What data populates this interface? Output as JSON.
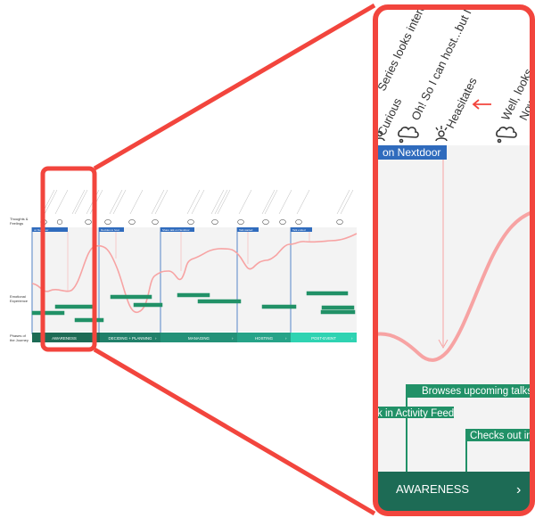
{
  "row_labels": {
    "thoughts": [
      "Thoughts &",
      "Feelings"
    ],
    "emotional": [
      "Emotional",
      "Experience"
    ],
    "phases": [
      "Phases of",
      "the Journey"
    ]
  },
  "phases": [
    {
      "label": "AWARENESS",
      "color": "#1d6b55"
    },
    {
      "label": "DECIDING + PLANNING",
      "color": "#21806a"
    },
    {
      "label": "MANAGING",
      "color": "#239178"
    },
    {
      "label": "HOSTING",
      "color": "#26a388"
    },
    {
      "label": "POST-EVENT",
      "color": "#2fd3b2"
    }
  ],
  "phase_arrow": "›",
  "stage_headers": [
    "on Nextdoor",
    "Decides to host",
    "Share talk on Nextdoor",
    "Talk started",
    "Talk ended"
  ],
  "activity_notes": [
    "Browses upcoming talks",
    "k in Activity Feed",
    "Checks out info",
    "Fills out form",
    "Adds details",
    "Manages RSVPs",
    "Shares link",
    "Starts talk",
    "Leaves feedback",
    "Views recap"
  ],
  "thoughts": [
    "Series looks interesting.",
    "Curious",
    "Oh! So I can host...but I don't know how.",
    "Heasitates",
    "Well, looks",
    "Now, it"
  ],
  "colors": {
    "accent_red": "#f2453d",
    "blue": "#2f6bbd",
    "green": "#219167",
    "curve": "#f7a3a3",
    "chart_bg": "#f3f3f3"
  },
  "icons": [
    "thought-cloud-icon",
    "person-icon",
    "arrow-left-icon",
    "chevron-right-icon"
  ]
}
